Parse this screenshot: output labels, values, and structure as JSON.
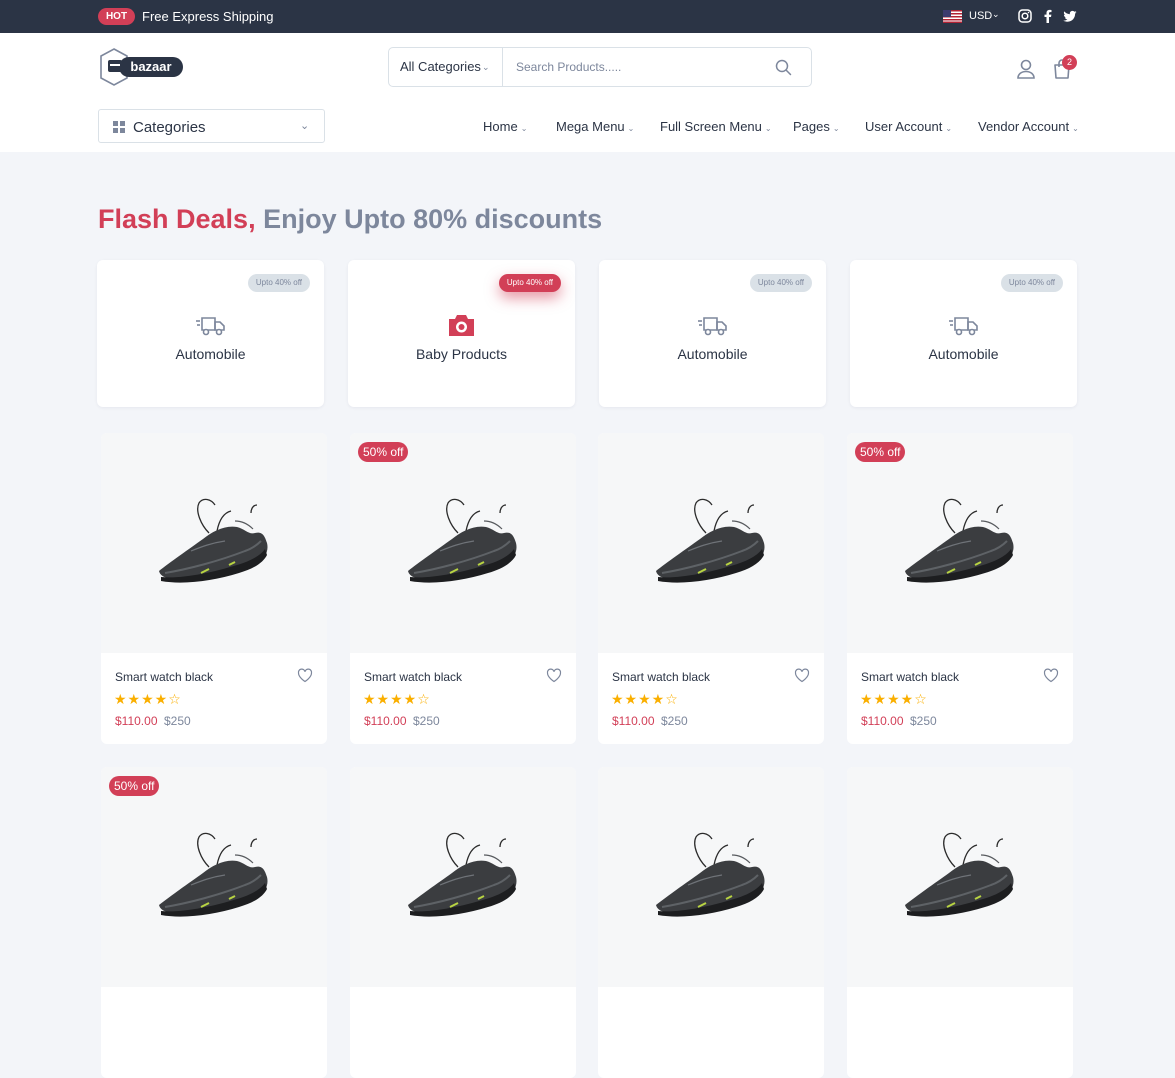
{
  "topbar": {
    "badge": "HOT",
    "promo": "Free Express Shipping",
    "currency": "USD",
    "flag_icon": "us-flag-icon",
    "socials": [
      "instagram-icon",
      "facebook-icon",
      "twitter-icon"
    ]
  },
  "header": {
    "logo_text": "bazaar",
    "search_category": "All Categories",
    "search_placeholder": "Search Products.....",
    "cart_count": "2"
  },
  "nav": {
    "categories_label": "Categories",
    "items": [
      {
        "label": "Home"
      },
      {
        "label": "Mega Menu"
      },
      {
        "label": "Full Screen Menu"
      },
      {
        "label": "Pages"
      },
      {
        "label": "User Account"
      },
      {
        "label": "Vendor Account"
      }
    ]
  },
  "flash": {
    "title_accent": "Flash Deals,",
    "title_rest": "Enjoy Upto 80% discounts",
    "deals": [
      {
        "name": "Automobile",
        "discount": "Upto 40% off",
        "icon": "truck-icon"
      },
      {
        "name": "Baby Products",
        "discount": "Upto 40% off",
        "icon": "camera-icon"
      },
      {
        "name": "Automobile",
        "discount": "Upto 40% off",
        "icon": "truck-icon"
      },
      {
        "name": "Automobile",
        "discount": "Upto 40% off",
        "icon": "truck-icon"
      }
    ]
  },
  "products": [
    {
      "name": "Smart watch black",
      "price": "$110.00",
      "old_price": "$250",
      "badge": "",
      "rating": 4
    },
    {
      "name": "Smart watch black",
      "price": "$110.00",
      "old_price": "$250",
      "badge": "50% off",
      "rating": 4
    },
    {
      "name": "Smart watch black",
      "price": "$110.00",
      "old_price": "$250",
      "badge": "",
      "rating": 4
    },
    {
      "name": "Smart watch black",
      "price": "$110.00",
      "old_price": "$250",
      "badge": "50% off",
      "rating": 4
    },
    {
      "name": "",
      "price": "",
      "old_price": "",
      "badge": "50% off",
      "rating": 0
    },
    {
      "name": "",
      "price": "",
      "old_price": "",
      "badge": "",
      "rating": 0
    },
    {
      "name": "",
      "price": "",
      "old_price": "",
      "badge": "",
      "rating": 0
    },
    {
      "name": "",
      "price": "",
      "old_price": "",
      "badge": "",
      "rating": 0
    }
  ],
  "colors": {
    "primary": "#d23f57",
    "dark": "#2b3445",
    "muted": "#7d879c",
    "star": "#faaf00"
  }
}
